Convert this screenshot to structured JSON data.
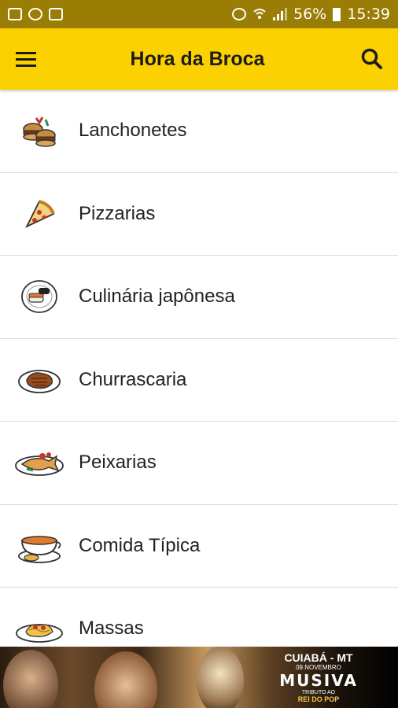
{
  "status_bar": {
    "battery": "56%",
    "time": "15:39"
  },
  "app_bar": {
    "title": "Hora da Broca",
    "menu_icon": "hamburger-menu-icon",
    "search_icon": "search-icon"
  },
  "categories": [
    {
      "label": "Lanchonetes",
      "icon": "burger-icon"
    },
    {
      "label": "Pizzarias",
      "icon": "pizza-slice-icon"
    },
    {
      "label": "Culinária japônesa",
      "icon": "sushi-plate-icon"
    },
    {
      "label": "Churrascaria",
      "icon": "steak-plate-icon"
    },
    {
      "label": "Peixarias",
      "icon": "fish-plate-icon"
    },
    {
      "label": "Comida Típica",
      "icon": "soup-bowl-icon"
    },
    {
      "label": "Massas",
      "icon": "pasta-plate-icon"
    }
  ],
  "banner": {
    "city": "CUIABÁ - MT",
    "date": "09.NOVEMBRO",
    "brand": "MUSIVA",
    "line1": "TRIBUTO AO",
    "line2": "REI DO POP"
  },
  "colors": {
    "app_bar": "#fcd101",
    "status_bar": "#9a7d05"
  }
}
